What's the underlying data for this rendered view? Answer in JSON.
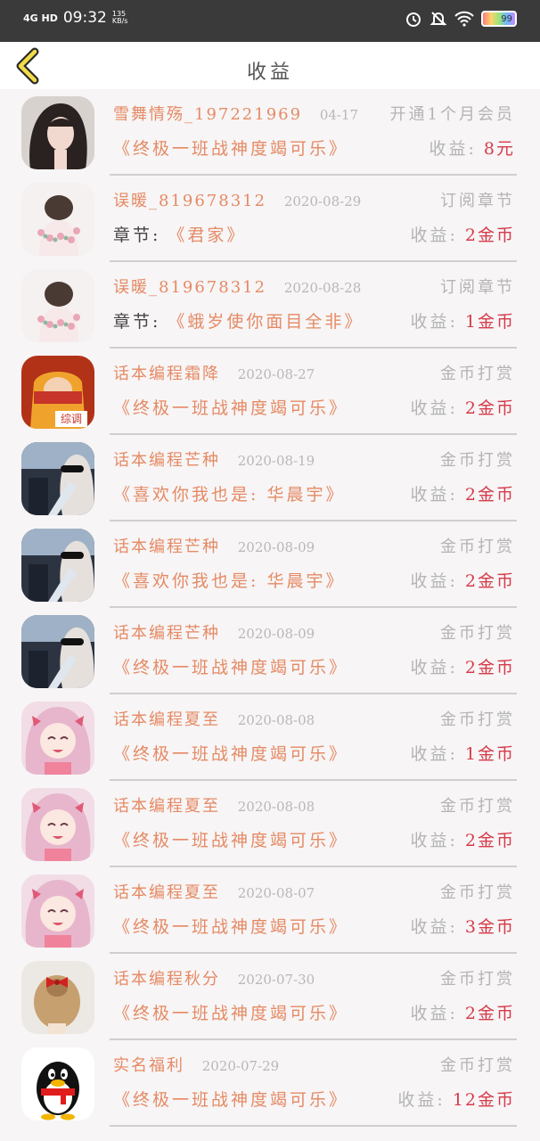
{
  "status_bar": {
    "network": "4G HD",
    "time": "09:32",
    "speed": "135 KB/s",
    "battery": "99"
  },
  "header": {
    "title": "收益"
  },
  "colors": {
    "name": "#e58a64",
    "earning": "#d63b4a",
    "muted": "#b4b4b4",
    "header_bg": "#ffffff",
    "status_bg": "#3a3a3a"
  },
  "records": [
    {
      "name": "雪舞情殇_197221969",
      "date": "04-17",
      "type": "开通1个月会员",
      "prefix": "",
      "work": "《终极一班战神度竭可乐》",
      "earn_label": "收益:",
      "earn_value": "8元",
      "avatar": "avatar-woman-dark-hair"
    },
    {
      "name": "误暖_819678312",
      "date": "2020-08-29",
      "type": "订阅章节",
      "prefix": "章节:",
      "work": "《君家》",
      "earn_label": "收益:",
      "earn_value": "2金币",
      "avatar": "avatar-flower-back"
    },
    {
      "name": "误暖_819678312",
      "date": "2020-08-28",
      "type": "订阅章节",
      "prefix": "章节:",
      "work": "《蛾岁使你面目全非》",
      "earn_label": "收益:",
      "earn_value": "1金币",
      "avatar": "avatar-flower-back"
    },
    {
      "name": "话本编程霜降",
      "date": "2020-08-27",
      "type": "金币打赏",
      "prefix": "",
      "work": "《终极一班战神度竭可乐》",
      "earn_label": "收益:",
      "earn_value": "2金币",
      "avatar": "avatar-cartoon-red"
    },
    {
      "name": "话本编程芒种",
      "date": "2020-08-19",
      "type": "金币打赏",
      "prefix": "",
      "work": "《喜欢你我也是: 华晨宇》",
      "earn_label": "收益:",
      "earn_value": "2金币",
      "avatar": "avatar-car-selfie"
    },
    {
      "name": "话本编程芒种",
      "date": "2020-08-09",
      "type": "金币打赏",
      "prefix": "",
      "work": "《喜欢你我也是: 华晨宇》",
      "earn_label": "收益:",
      "earn_value": "2金币",
      "avatar": "avatar-car-selfie"
    },
    {
      "name": "话本编程芒种",
      "date": "2020-08-09",
      "type": "金币打赏",
      "prefix": "",
      "work": "《终极一班战神度竭可乐》",
      "earn_label": "收益:",
      "earn_value": "2金币",
      "avatar": "avatar-car-selfie"
    },
    {
      "name": "话本编程夏至",
      "date": "2020-08-08",
      "type": "金币打赏",
      "prefix": "",
      "work": "《终极一班战神度竭可乐》",
      "earn_label": "收益:",
      "earn_value": "1金币",
      "avatar": "avatar-anime-girl"
    },
    {
      "name": "话本编程夏至",
      "date": "2020-08-08",
      "type": "金币打赏",
      "prefix": "",
      "work": "《终极一班战神度竭可乐》",
      "earn_label": "收益:",
      "earn_value": "2金币",
      "avatar": "avatar-anime-girl"
    },
    {
      "name": "话本编程夏至",
      "date": "2020-08-07",
      "type": "金币打赏",
      "prefix": "",
      "work": "《终极一班战神度竭可乐》",
      "earn_label": "收益:",
      "earn_value": "3金币",
      "avatar": "avatar-anime-girl"
    },
    {
      "name": "话本编程秋分",
      "date": "2020-07-30",
      "type": "金币打赏",
      "prefix": "",
      "work": "《终极一班战神度竭可乐》",
      "earn_label": "收益:",
      "earn_value": "2金币",
      "avatar": "avatar-bow-hair"
    },
    {
      "name": "实名福利",
      "date": "2020-07-29",
      "type": "金币打赏",
      "prefix": "",
      "work": "《终极一班战神度竭可乐》",
      "earn_label": "收益:",
      "earn_value": "12金币",
      "avatar": "avatar-penguin"
    }
  ]
}
